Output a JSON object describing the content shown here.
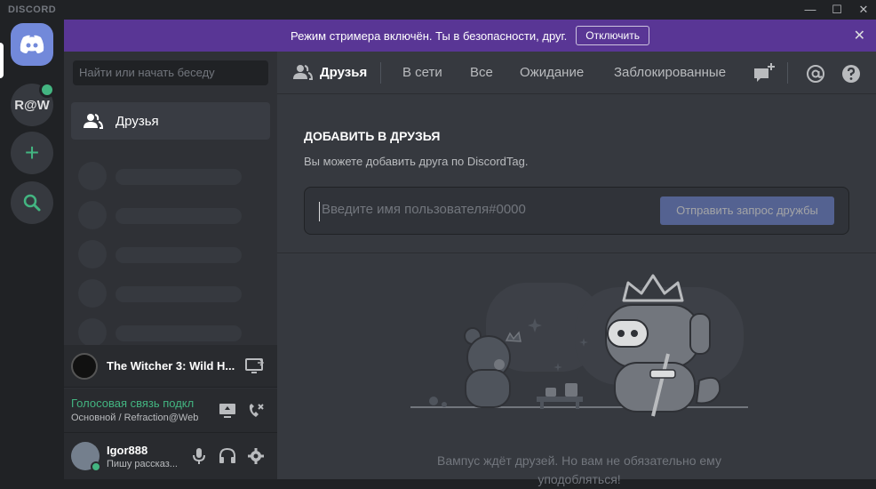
{
  "titlebar": {
    "brand": "DISCORD",
    "min": "—",
    "max": "☐",
    "close": "✕"
  },
  "guilds": [
    {
      "name": "discord-home",
      "label": ""
    },
    {
      "name": "raw-server",
      "label": "R@W"
    },
    {
      "name": "add-server",
      "label": "+"
    },
    {
      "name": "explore",
      "label": ""
    }
  ],
  "streamer": {
    "message": "Режим стримера включён. Ты в безопасности, друг.",
    "button": "Отключить",
    "close": "✕"
  },
  "sidebar": {
    "search_placeholder": "Найти или начать беседу",
    "friends_label": "Друзья"
  },
  "activity": {
    "game": "The Witcher 3: Wild H..."
  },
  "voice": {
    "status": "Голосовая связь подкл",
    "channel": "Основной / Refraction@Web"
  },
  "user": {
    "name": "Igor888",
    "status": "Пишу рассказ..."
  },
  "tabs": [
    {
      "label": "Друзья"
    },
    {
      "label": "В сети"
    },
    {
      "label": "Все"
    },
    {
      "label": "Ожидание"
    },
    {
      "label": "Заблокированные"
    }
  ],
  "add_friend": {
    "title": "ДОБАВИТЬ В ДРУЗЬЯ",
    "description": "Вы можете добавить друга по DiscordTag.",
    "input_placeholder": "Введите имя пользователя#0000",
    "button": "Отправить запрос дружбы"
  },
  "empty_state": {
    "text": "Вампус ждёт друзей. Но вам не обязательно ему уподобляться!"
  },
  "colors": {
    "blurple": "#7289da",
    "streamer_bar": "#593695",
    "green": "#43b581",
    "background": "#36393f",
    "sidebar": "#2f3136",
    "guild_bar": "#202225"
  }
}
